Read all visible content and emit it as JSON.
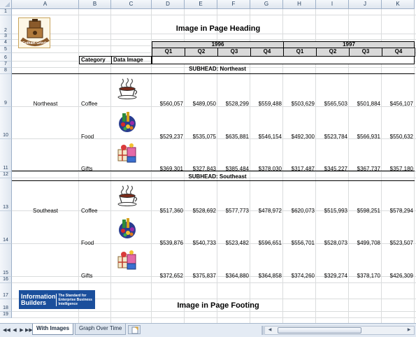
{
  "columns": [
    "A",
    "B",
    "C",
    "D",
    "E",
    "F",
    "G",
    "H",
    "I",
    "J",
    "K"
  ],
  "rows": [
    "1",
    "2",
    "3",
    "4",
    "5",
    "6",
    "7",
    "8",
    "9",
    "10",
    "11",
    "12",
    "13",
    "14",
    "15",
    "16",
    "17",
    "18",
    "19"
  ],
  "page_heading": "Image in Page Heading",
  "page_footing": "Image in Page Footing",
  "logo_text": "Gotham Grinds",
  "years": [
    "1996",
    "1997"
  ],
  "quarters": [
    "Q1",
    "Q2",
    "Q3",
    "Q4",
    "Q1",
    "Q2",
    "Q3",
    "Q4"
  ],
  "headers": {
    "category": "Category",
    "data_image": "Data Image"
  },
  "sections": [
    {
      "subhead": "SUBHEAD: Northeast",
      "region": "Northeast",
      "rows": [
        {
          "category": "Coffee",
          "icon": "coffee-cup-icon",
          "values": [
            "$560,057",
            "$489,050",
            "$528,299",
            "$559,488",
            "$503,629",
            "$565,503",
            "$501,884",
            "$456,107"
          ]
        },
        {
          "category": "Food",
          "icon": "food-basket-icon",
          "values": [
            "$529,237",
            "$535,075",
            "$635,881",
            "$546,154",
            "$492,300",
            "$523,784",
            "$566,931",
            "$550,632"
          ]
        },
        {
          "category": "Gifts",
          "icon": "gift-box-icon",
          "values": [
            "$369,301",
            "$327,843",
            "$385,484",
            "$378,030",
            "$317,487",
            "$345,227",
            "$367,737",
            "$357,180"
          ]
        }
      ]
    },
    {
      "subhead": "SUBHEAD: Southeast",
      "region": "Southeast",
      "rows": [
        {
          "category": "Coffee",
          "icon": "coffee-cup-icon",
          "values": [
            "$517,360",
            "$528,692",
            "$577,773",
            "$478,972",
            "$620,073",
            "$515,993",
            "$598,251",
            "$578,294"
          ]
        },
        {
          "category": "Food",
          "icon": "food-basket-icon",
          "values": [
            "$539,876",
            "$540,733",
            "$523,482",
            "$596,651",
            "$556,701",
            "$528,073",
            "$499,708",
            "$523,507"
          ]
        },
        {
          "category": "Gifts",
          "icon": "gift-box-icon",
          "values": [
            "$372,652",
            "$375,837",
            "$364,880",
            "$364,858",
            "$374,260",
            "$329,274",
            "$378,170",
            "$426,309"
          ]
        }
      ]
    }
  ],
  "footer_logo": {
    "brand": "Information Builders",
    "tagline": "The Standard for Enterprise Business Intelligence"
  },
  "tabs": [
    {
      "label": "With Images",
      "active": true
    },
    {
      "label": "Graph Over Time",
      "active": false
    }
  ],
  "nav_buttons": [
    "◀◀",
    "◀",
    "▶",
    "▶▶"
  ],
  "colors": {
    "header_gray": "#d9d9d9",
    "tab_bg": "#e4ebf4",
    "ib_blue": "#1b4f9c"
  }
}
